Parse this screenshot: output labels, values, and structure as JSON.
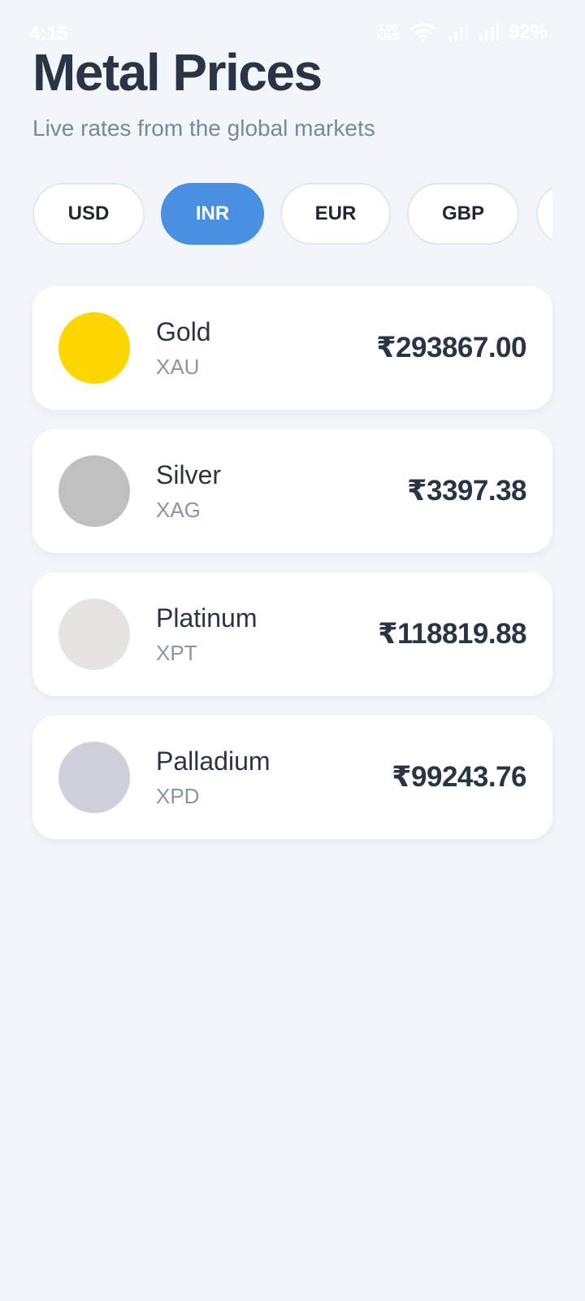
{
  "status_bar": {
    "time": "4:15",
    "net_speed_value": "1.00",
    "net_speed_unit": "KB/S",
    "battery": "92%",
    "icons": [
      "wifi-icon",
      "signal-icon",
      "signal-icon"
    ]
  },
  "header": {
    "title": "Metal Prices",
    "subtitle": "Live rates from the global markets"
  },
  "currencies": {
    "selected": "INR",
    "items": [
      "USD",
      "INR",
      "EUR",
      "GBP",
      ""
    ]
  },
  "colors": {
    "background": "#f2f6fb",
    "accent": "#4a90e2",
    "gold": "#ffd700",
    "silver": "#c0c0c0",
    "platinum": "#e5e4e2",
    "palladium": "#cfd0dc"
  },
  "metals": [
    {
      "name": "Gold",
      "symbol": "XAU",
      "price": "₹293867.00"
    },
    {
      "name": "Silver",
      "symbol": "XAG",
      "price": "₹3397.38"
    },
    {
      "name": "Platinum",
      "symbol": "XPT",
      "price": "₹118819.88"
    },
    {
      "name": "Palladium",
      "symbol": "XPD",
      "price": "₹99243.76"
    }
  ]
}
